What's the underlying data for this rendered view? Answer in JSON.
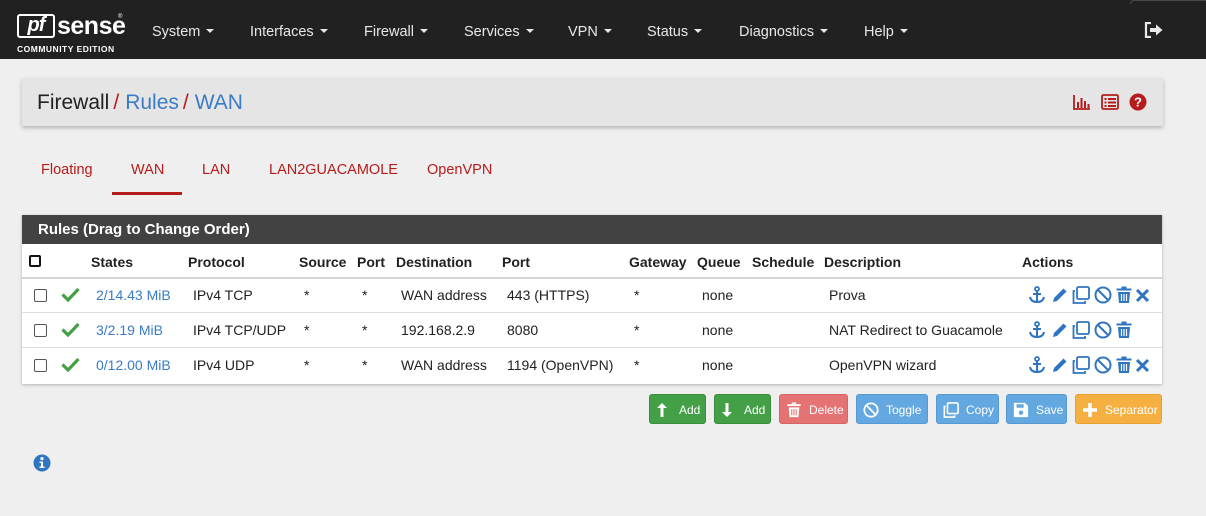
{
  "brand": {
    "logo_pf": "pf",
    "logo_sense": "sense",
    "edition": "COMMUNITY EDITION"
  },
  "nav": {
    "items": [
      {
        "label": "System"
      },
      {
        "label": "Interfaces"
      },
      {
        "label": "Firewall"
      },
      {
        "label": "Services"
      },
      {
        "label": "VPN"
      },
      {
        "label": "Status"
      },
      {
        "label": "Diagnostics"
      },
      {
        "label": "Help"
      }
    ],
    "logout_icon": "sign-out-icon"
  },
  "breadcrumb": {
    "root": "Firewall",
    "level1": "Rules",
    "level2": "WAN",
    "separator": "/"
  },
  "header_icons": [
    "bar-chart-icon",
    "list-icon",
    "help-icon"
  ],
  "tabs": [
    {
      "label": "Floating",
      "active": false
    },
    {
      "label": "WAN",
      "active": true
    },
    {
      "label": "LAN",
      "active": false
    },
    {
      "label": "LAN2GUACAMOLE",
      "active": false
    },
    {
      "label": "OpenVPN",
      "active": false
    }
  ],
  "rules_panel": {
    "title": "Rules (Drag to Change Order)",
    "columns": [
      "States",
      "Protocol",
      "Source",
      "Port",
      "Destination",
      "Port",
      "Gateway",
      "Queue",
      "Schedule",
      "Description",
      "Actions"
    ],
    "rows": [
      {
        "states": "2/14.43 MiB",
        "protocol": "IPv4 TCP",
        "source": "*",
        "src_port": "*",
        "destination": "WAN address",
        "dst_port": "443 (HTTPS)",
        "gateway": "*",
        "queue": "none",
        "schedule": "",
        "description": "Prova",
        "has_delete_x": true
      },
      {
        "states": "3/2.19 MiB",
        "protocol": "IPv4 TCP/UDP",
        "source": "*",
        "src_port": "*",
        "destination": "192.168.2.9",
        "dst_port": "8080",
        "gateway": "*",
        "queue": "none",
        "schedule": "",
        "description": "NAT Redirect to Guacamole",
        "has_delete_x": false
      },
      {
        "states": "0/12.00 MiB",
        "protocol": "IPv4 UDP",
        "source": "*",
        "src_port": "*",
        "destination": "WAN address",
        "dst_port": "1194 (OpenVPN)",
        "gateway": "*",
        "queue": "none",
        "schedule": "",
        "description": "OpenVPN wizard",
        "has_delete_x": true
      }
    ]
  },
  "buttons": {
    "add_top": "Add",
    "add_bottom": "Add",
    "delete": "Delete",
    "toggle": "Toggle",
    "copy": "Copy",
    "save": "Save",
    "separator": "Separator"
  },
  "colors": {
    "navbar_bg": "#212121",
    "accent_red": "#b71c1c",
    "link_blue": "#3a7bc8",
    "success_green": "#43a047",
    "danger_red": "#e57373",
    "info_blue": "#64a8e2",
    "warning_orange": "#f5b041"
  }
}
